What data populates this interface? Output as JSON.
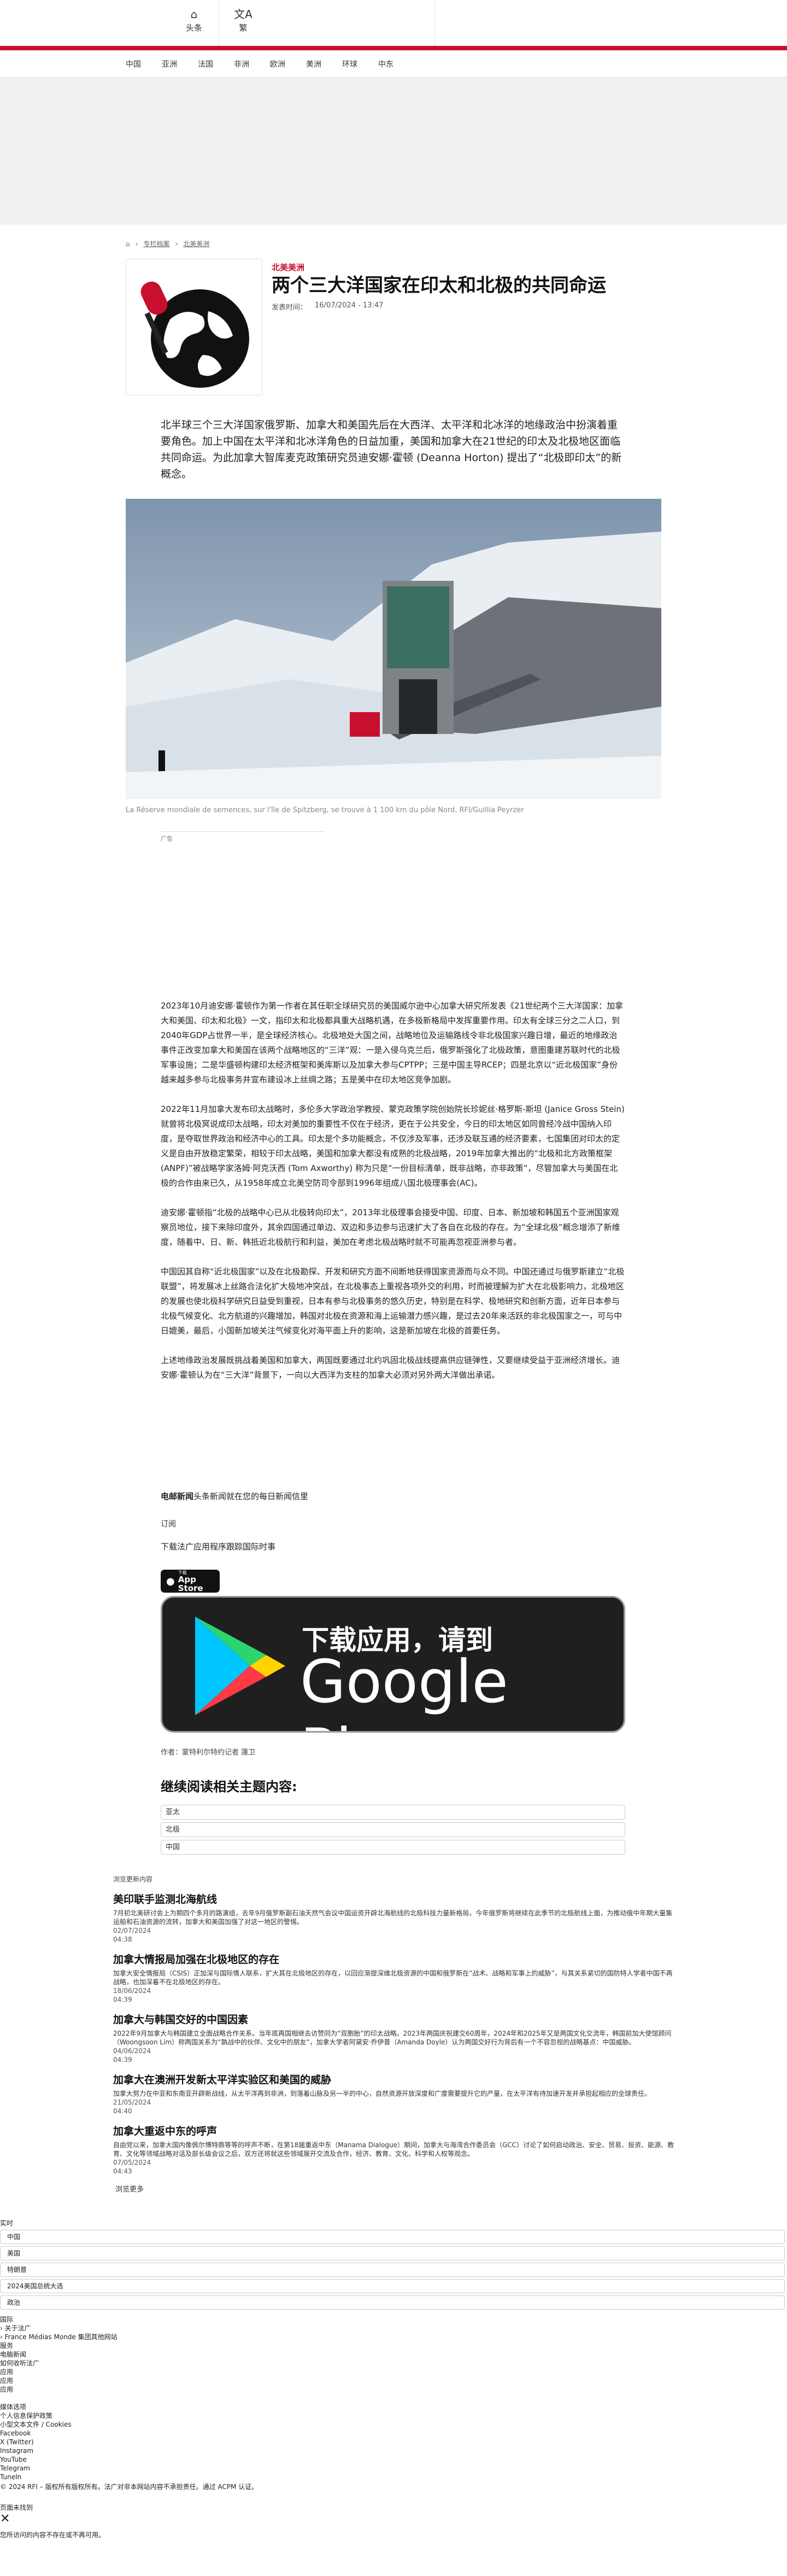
{
  "header": {
    "home_label": "头条",
    "lang_label": "繁",
    "nav": [
      "中国",
      "亚洲",
      "法国",
      "非洲",
      "欧洲",
      "美洲",
      "环球",
      "中东"
    ]
  },
  "breadcrumb": [
    "专栏档案",
    "北美美洲"
  ],
  "article": {
    "category": "北美美洲",
    "title": "两个三大洋国家在印太和北极的共同命运",
    "published_label": "发表时间：",
    "published": "16/07/2024 - 13:47",
    "lead": "北半球三个三大洋国家俄罗斯、加拿大和美国先后在大西洋、太平洋和北冰洋的地缘政治中扮演着重要角色。加上中国在太平洋和北冰洋角色的日益加重，美国和加拿大在21世纪的印太及北极地区面临共同命运。为此加拿大智库麦克政策研究员迪安娜·霍顿 (Deanna Horton) 提出了“北极即印太”的新概念。",
    "photo_caption": "La Réserve mondiale de semences, sur l'île de Spitzberg, se trouve à 1 100 km du pôle Nord. RFI/Guillia Peyrzer",
    "ad_label": "广告",
    "paragraphs": [
      "2023年10月迪安娜·霍顿作为第一作者在其任职全球研究员的美国威尔逊中心加拿大研究所发表《21世纪两个三大洋国家：加拿大和美国、印太和北极》一文，指印太和北极都具重大战略机遇，在多极新格局中发挥重要作用。印太有全球三分之二人口，到2040年GDP占世界一半，是全球经济核心。北极地处大国之间，战略地位及运输路线令非北极国家兴趣日增，最近的地缘政治事件正改变加拿大和美国在该两个战略地区的“三洋”观：一是入侵乌克兰后，俄罗斯强化了北极政策，意图重建苏联时代的北极军事设施；二是华盛顿构建印太经济框架和美库斯以及加拿大参与CPTPP；三是中国主导RCEP；四是北京以“近北极国家”身份越来越多参与北极事务并宣布建设冰上丝绸之路；五是美中在印太地区竞争加剧。",
      "2022年11月加拿大发布印太战略时，多伦多大学政治学教授、蒙克政策学院创始院长珍妮丝·格罗斯-斯坦 (Janice Gross Stein) 就曾将北极冥说成印太战略，印太对美加的重要性不仅在于经济，更在于公共安全，今日的印太地区如同曾经冷战中国纳入印度，是夺取世界政治和经济中心的工具。印太是个多功能概念，不仅涉及军事，还涉及联互通的经济要素，七国集团对印太的定义是自由开放稳定繁荣，相较于印太战略，美国和加拿大都没有成熟的北极战略，2019年加拿大推出的“北极和北方政策框架(ANPF)”被战略学家洛姆·阿克沃西 (Tom Axworthy) 称为只是“一份目标清单，既非战略，亦非政策”，尽管加拿大与美国在北极的合作由来已久，从1958年成立北美空防司令部到1996年组成八国北极理事会(AC)。",
      "迪安娜·霍顿指“北极的战略中心已从北极转向印太”，2013年北极理事会接受中国、印度、日本、新加坡和韩国五个亚洲国家观察员地位，接下来除印度外，其余四国通过单边、双边和多边参与迅速扩大了各自在北极的存在。为“全球北极”概念增添了新维度，随着中、日、新、韩抵近北极航行和利益，美加在考虑北极战略时就不可能再忽视亚洲参与者。",
      "中国因其自称“近北极国家”以及在北极勘探、开发和研究方面不间断地获得国家资源而与众不同。中国还通过与俄罗斯建立“北极联盟”，将发展冰上丝路合法化扩大极地冲突战，在北极事态上重视各项外交的利用，时而被理解为扩大在北极影响力，北极地区的发展也使北极科学研究日益受到重视，日本有参与北极事务的悠久历史，特别是在科学、极地研究和创新方面，近年日本参与北极气候变化、北方航道的兴趣增加，韩国对北极在资源和海上运输潜力感兴趣，是过去20年来活跃的非北极国家之一，可与中日媲美，最后，小国新加坡关注气候变化对海平面上升的影响，这是新加坡在北极的首要任务。",
      "上述地缘政治发展既挑战着美国和加拿大，两国既要通过北约巩固北极战线提高供应链弹性，又要继续受益于亚洲经济增长。迪安娜·霍顿认为在“三大洋”背景下，一向以大西洋为支柱的加拿大必须对另外两大洋做出承诺。"
    ],
    "tagline_brand": "电邮新闻",
    "tagline_text": "头条新闻就在您的每日新闻信里",
    "subscribe": "订阅",
    "download_text": "下载法广应用程序跟踪国际时事",
    "appstore_small": "下载",
    "appstore_big": "App Store",
    "gplay_line1": "下载应用，请到",
    "gplay_line2": "Google Play",
    "author_label": "作者：",
    "author": "蒙特利尔特约记者 蓮卫"
  },
  "related": {
    "heading": "继续阅读相关主题内容:",
    "tags": [
      "亚太",
      "北极",
      "中国"
    ]
  },
  "latest": {
    "heading": "浏览更新内容",
    "items": [
      {
        "title": "美印联手监测北海航线",
        "text": "7月初北美研讨会上为期四个多月的路演组，去年9月俄罗斯副石油天然气会议中国运资开辟北海航线的北极科技力量新格局，今年俄罗斯将继续在此季节的北极航线上面，为推动俄中年期大量集运船和石油资源的流转，加拿大和美国加强了对这一地区的警惕。",
        "date": "02/07/2024",
        "time": "04:38"
      },
      {
        "title": "加拿大情报局加强在北极地区的存在",
        "text": "加拿大安全情报局（CSIS）正加深与国际情人联系，扩大其在北极地区的存在，以回应渐提深维北极资源的中国和俄罗斯在“战术、战略和军事上的威胁”，与其关系紧切的国防特人学者中国不再战略，也加深着不在北极地区的存在。",
        "date": "18/06/2024",
        "time": "04:39"
      },
      {
        "title": "加拿大与韩国交好的中国因素",
        "text": "2022年9月加拿大与韩国建立全面战略合作关系。当年底再国相继去访赞同为“双胞胎”的印太战略。2023年两国庆祝建交60周年，2024年和2025年又是两国文化交流年，韩国前加大使馆顾问（Woongsoon Lim）称两国关系为“孰战中的伙伴、文化中的朋友”，加拿大学者阿黛安·乔伊普（Amanda Doyle）认为两国交好行为背后有一个不容忽视的战略基点：中国威胁。",
        "date": "04/06/2024",
        "time": "04:39"
      },
      {
        "title": "加拿大在澳洲开发新太平洋实验区和美国的威胁",
        "text": "加拿大努力在中亚和东南亚开辟新战线，从太平洋再到非洲，到落着山脉及另一半的中心，自然资源开放深度和广度需要提升它的产量，在太平洋有待加速开发并承担起相应的全球责任。",
        "date": "21/05/2024",
        "time": "04:40"
      },
      {
        "title": "加拿大重返中东的呼声",
        "text": "自由党以来，加拿大国内像佩尔博特鼎等等的呼声不断，在第18届重返中东（Manama Dialogue）期间，加拿大与海湾合作委员会（GCC）讨论了如何启动政治、安全、贸易、投资、能源、教育、文化等领域战略对话及部长级会议之后，双方还将就这些领域展开交流及合作，经济、教育、文化、科学和人权等观念。",
        "date": "07/05/2024",
        "time": "04:43"
      }
    ],
    "more": "浏览更多"
  },
  "footer": {
    "realtime": "实时",
    "chips": [
      "中国",
      "美国",
      "特朗普",
      "2024美国总统大选",
      "政治"
    ],
    "country_label": "国际",
    "about_label": "关于法广",
    "group_label": "France Médias Monde 集团其他网站",
    "links": [
      "服务",
      "电脑新闻",
      "如何收听法广",
      "应用",
      "应用",
      "应用"
    ],
    "social_heading": "媒体选项",
    "social": [
      "个人信息保护政策",
      "小型文本文件 / Cookies",
      "Facebook",
      "X (Twitter)",
      "Instagram",
      "YouTube",
      "Telegram",
      "TuneIn"
    ],
    "copyright": "© 2024 RFI – 版权所有版权所有。法广对非本网站内容不承担责任。通过 ACPM 认证。",
    "notfound_title": "页面未找到",
    "notfound_text": "您所访问的内容不存在或不再可用。"
  },
  "colors": {
    "accent": "#c8102e"
  }
}
